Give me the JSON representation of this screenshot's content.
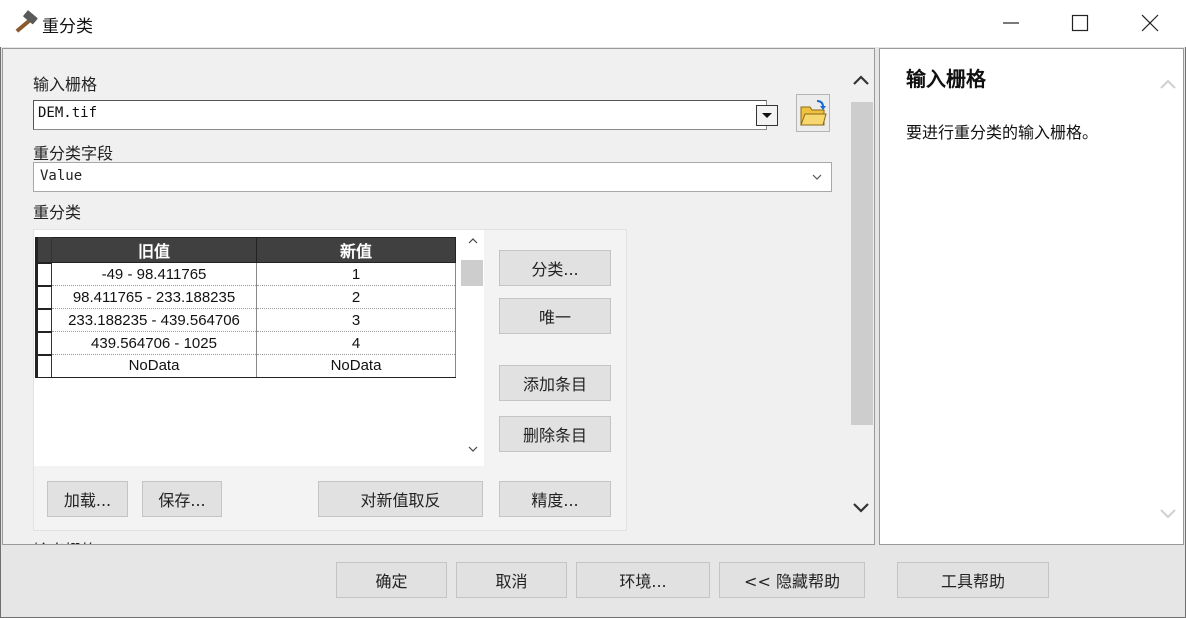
{
  "window": {
    "title": "重分类",
    "icon": "hammer-icon",
    "controls": [
      "minimize-icon",
      "maximize-icon",
      "close-icon"
    ]
  },
  "form": {
    "input_raster": {
      "label": "输入栅格",
      "value": "DEM.tif",
      "browse_icon": "open-folder-icon"
    },
    "reclass_field": {
      "label": "重分类字段",
      "value": "Value"
    },
    "reclassification": {
      "label": "重分类",
      "columns": [
        "旧值",
        "新值"
      ],
      "rows": [
        {
          "old": "-49 - 98.411765",
          "new": "1"
        },
        {
          "old": "98.411765 - 233.188235",
          "new": "2"
        },
        {
          "old": "233.188235 - 439.564706",
          "new": "3"
        },
        {
          "old": "439.564706 - 1025",
          "new": "4"
        },
        {
          "old": "NoData",
          "new": "NoData"
        }
      ],
      "buttons": {
        "classify": "分类...",
        "unique": "唯一",
        "add_entry": "添加条目",
        "delete_entry": "删除条目",
        "load": "加载...",
        "save": "保存...",
        "reverse": "对新值取反",
        "precision": "精度..."
      }
    },
    "output_raster": {
      "label": "输出栅格"
    }
  },
  "help": {
    "title": "输入栅格",
    "text": "要进行重分类的输入栅格。"
  },
  "footer": {
    "ok": "确定",
    "cancel": "取消",
    "environments": "环境...",
    "hide_help": "<< 隐藏帮助",
    "tool_help": "工具帮助"
  },
  "colors": {
    "header_bg": "#404040",
    "panel_bg": "#f0f0f0",
    "button_bg": "#e1e1e1"
  }
}
